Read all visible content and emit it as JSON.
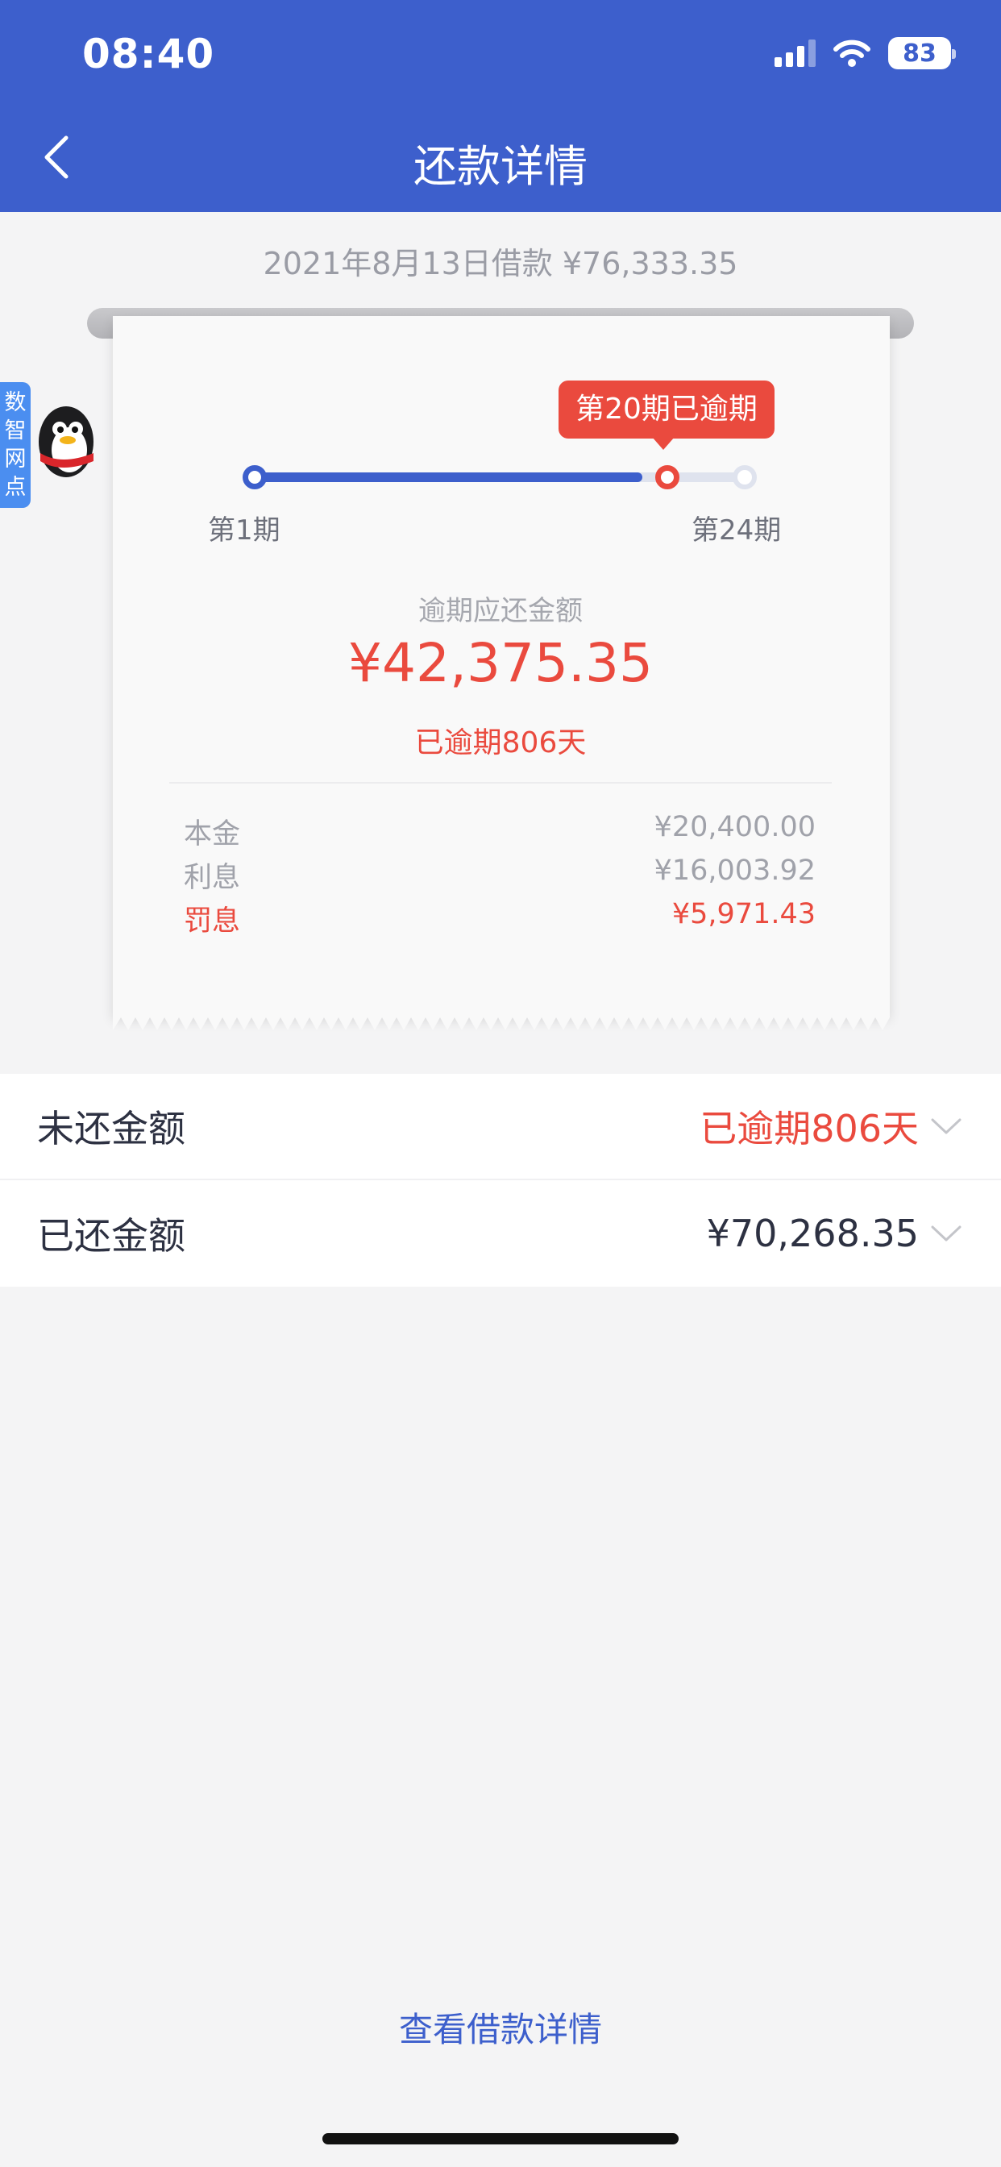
{
  "status_bar": {
    "time": "08:40",
    "battery": "83"
  },
  "header": {
    "title": "还款详情"
  },
  "loan_info": "2021年8月13日借款 ¥76,333.35",
  "floating_widget": {
    "label": "数智网点"
  },
  "timeline": {
    "current_tooltip": "第20期已逾期",
    "start_label": "第1期",
    "end_label": "第24期",
    "progress_fraction": 0.79
  },
  "receipt": {
    "caption": "逾期应还金额",
    "amount": "¥42,375.35",
    "overdue_text": "已逾期806天",
    "breakdown": [
      {
        "label": "本金",
        "value": "¥20,400.00"
      },
      {
        "label": "利息",
        "value": "¥16,003.92"
      },
      {
        "label": "罚息",
        "value": "¥5,971.43"
      }
    ]
  },
  "summary": [
    {
      "label": "未还金额",
      "value": "已逾期806天"
    },
    {
      "label": "已还金额",
      "value": "¥70,268.35"
    }
  ],
  "footer_link": "查看借款详情",
  "colors": {
    "brand": "#3d5fcc",
    "danger": "#ea4a3e",
    "background": "#f4f4f5"
  }
}
